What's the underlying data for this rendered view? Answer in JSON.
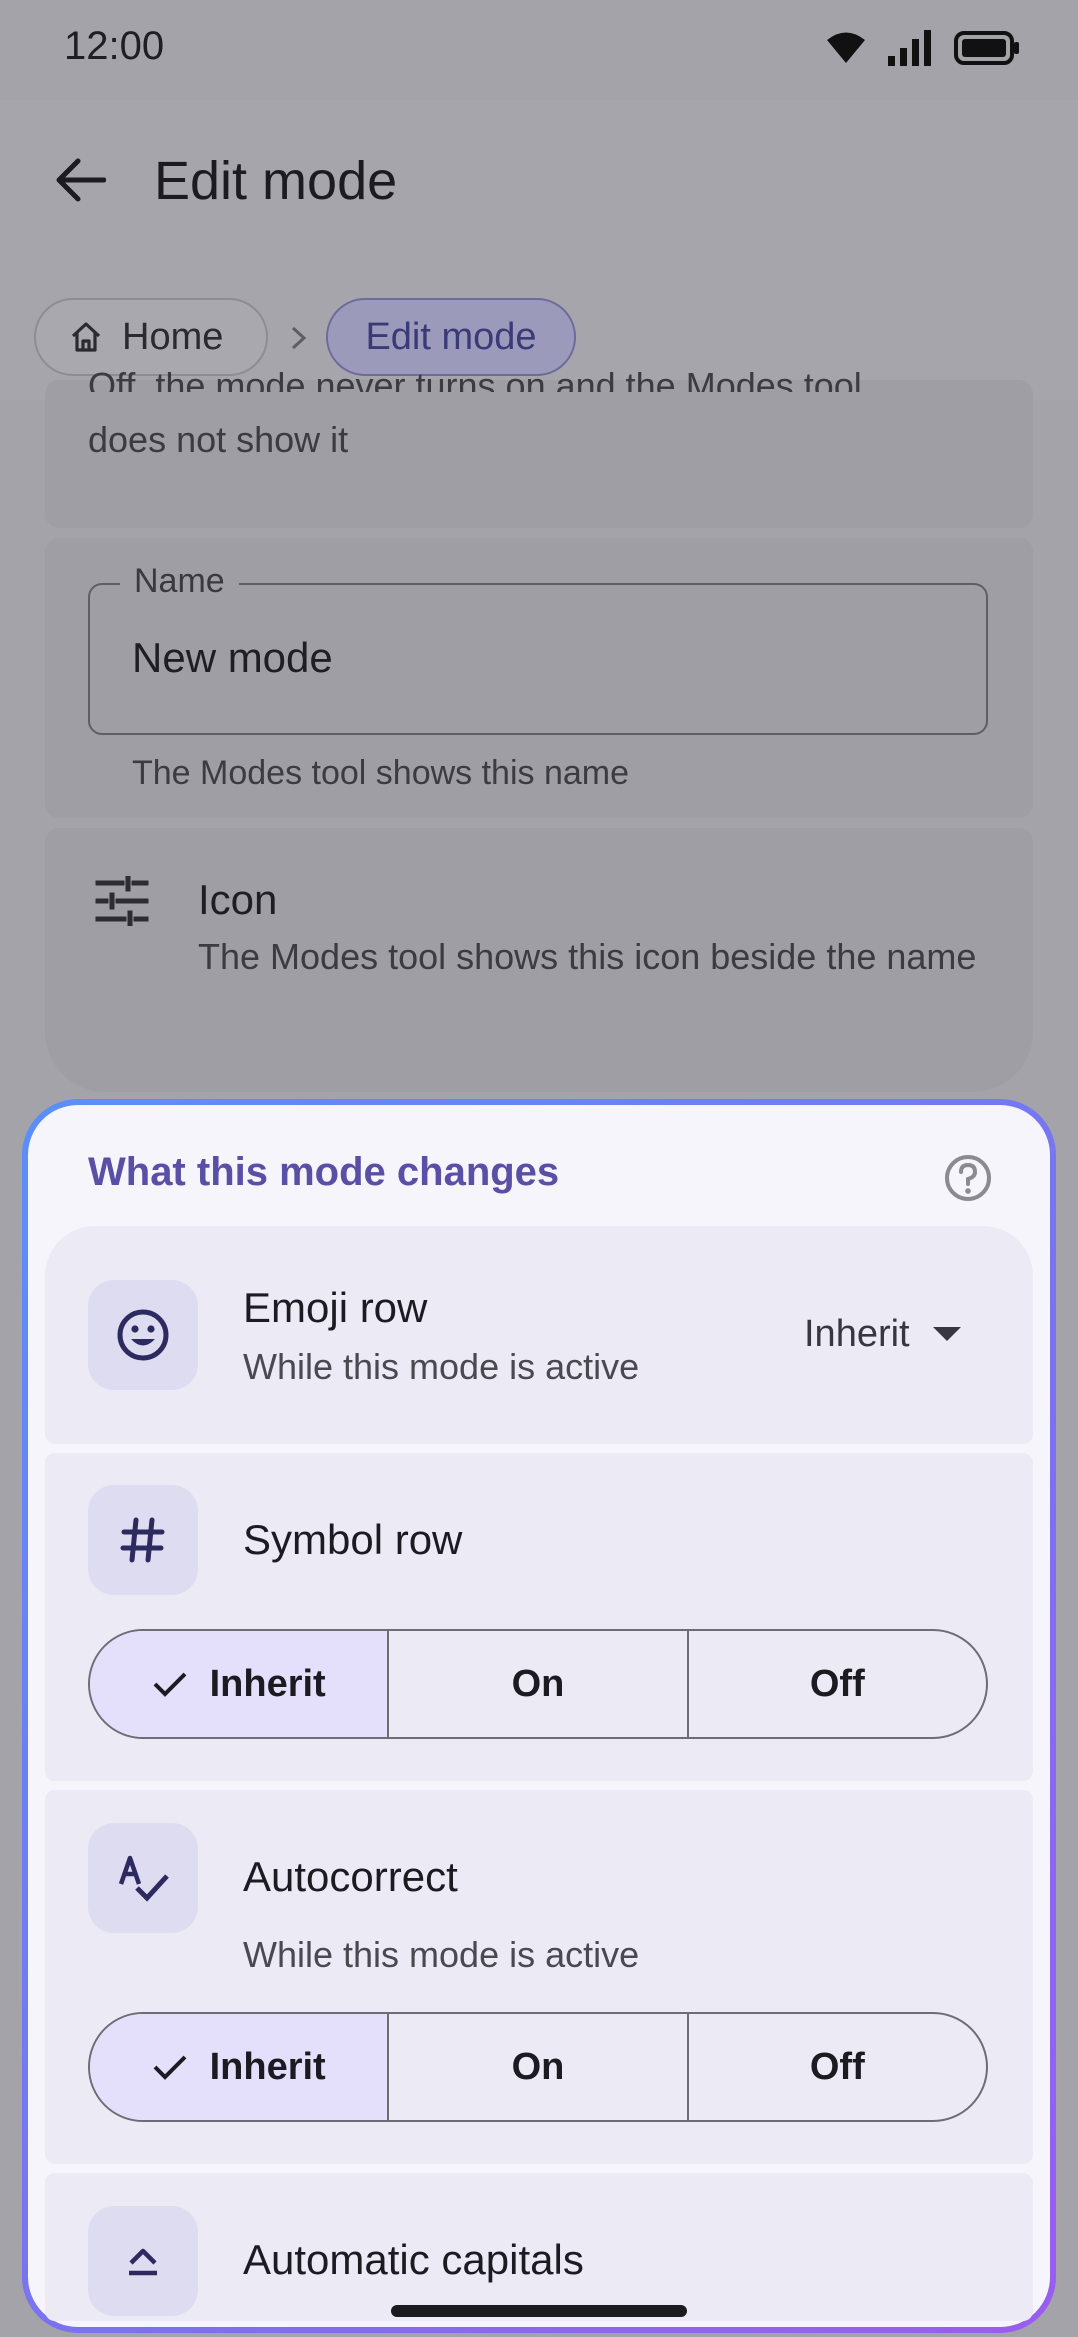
{
  "status_bar": {
    "time": "12:00"
  },
  "app_bar": {
    "title": "Edit mode",
    "back_icon": "arrow-back-icon"
  },
  "breadcrumb": {
    "home": "Home",
    "current": "Edit mode"
  },
  "off_description": {
    "line1": "Off, the mode never turns on and the Modes tool",
    "line2": "does not show it"
  },
  "name_field": {
    "label": "Name",
    "value": "New mode",
    "helper": "The Modes tool shows this name"
  },
  "icon_setting": {
    "title": "Icon",
    "description": "The Modes tool shows this icon beside the name"
  },
  "changes_panel": {
    "title": "What this mode changes",
    "help_icon": "help-circle-icon",
    "accent_color": "#5a4fa6",
    "items": [
      {
        "title": "Emoji row",
        "subtitle": "While this mode is active",
        "icon": "smiley-icon",
        "control": "dropdown",
        "value": "Inherit"
      },
      {
        "title": "Symbol row",
        "icon": "hash-icon",
        "control": "segmented",
        "options": [
          "Inherit",
          "On",
          "Off"
        ],
        "selected": "Inherit"
      },
      {
        "title": "Autocorrect",
        "subtitle": "While this mode is active",
        "icon": "spellcheck-icon",
        "control": "segmented",
        "options": [
          "Inherit",
          "On",
          "Off"
        ],
        "selected": "Inherit"
      },
      {
        "title": "Automatic capitals",
        "icon": "caret-up-icon"
      }
    ]
  }
}
